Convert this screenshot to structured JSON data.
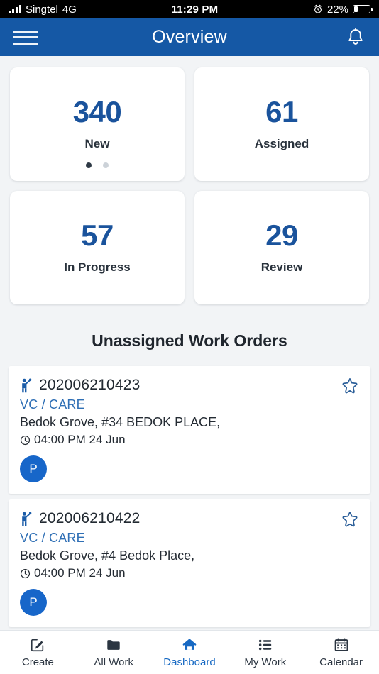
{
  "status_bar": {
    "carrier": "Singtel",
    "network": "4G",
    "time": "11:29 PM",
    "battery_percent": "22%",
    "battery_level": 22,
    "alarm_icon": "alarm-clock-icon",
    "signal_icon": "signal-bars-icon"
  },
  "app_bar": {
    "title": "Overview",
    "menu_icon": "hamburger-menu-icon",
    "notification_icon": "bell-icon",
    "background_color": "#1558a5"
  },
  "stats": {
    "cards": [
      {
        "value": "340",
        "label": "New",
        "has_dots": true
      },
      {
        "value": "61",
        "label": "Assigned",
        "has_dots": false
      },
      {
        "value": "57",
        "label": "In Progress",
        "has_dots": false
      },
      {
        "value": "29",
        "label": "Review",
        "has_dots": false
      }
    ],
    "pager": {
      "total": 2,
      "active_index": 0
    },
    "value_color": "#1a539c"
  },
  "orders_section": {
    "title": "Unassigned Work Orders",
    "orders": [
      {
        "id": "202006210423",
        "type": "VC / CARE",
        "address": "Bedok Grove, #34 BEDOK PLACE,",
        "time": "04:00 PM 24 Jun",
        "avatar_initial": "P",
        "worker_icon": "worker-person-icon",
        "star_icon": "star-outline-icon",
        "clock_icon": "clock-icon"
      },
      {
        "id": "202006210422",
        "type": "VC / CARE",
        "address": "Bedok Grove, #4 Bedok Place,",
        "time": "04:00 PM 24 Jun",
        "avatar_initial": "P",
        "worker_icon": "worker-person-icon",
        "star_icon": "star-outline-icon",
        "clock_icon": "clock-icon"
      }
    ],
    "type_color": "#2f6fb5",
    "avatar_color": "#1766c9"
  },
  "bottom_nav": {
    "active": "Dashboard",
    "items": [
      {
        "label": "Create",
        "icon": "pencil-square-icon"
      },
      {
        "label": "All Work",
        "icon": "folder-icon"
      },
      {
        "label": "Dashboard",
        "icon": "home-icon"
      },
      {
        "label": "My Work",
        "icon": "list-icon"
      },
      {
        "label": "Calendar",
        "icon": "calendar-icon"
      }
    ],
    "active_color": "#1769c3"
  }
}
